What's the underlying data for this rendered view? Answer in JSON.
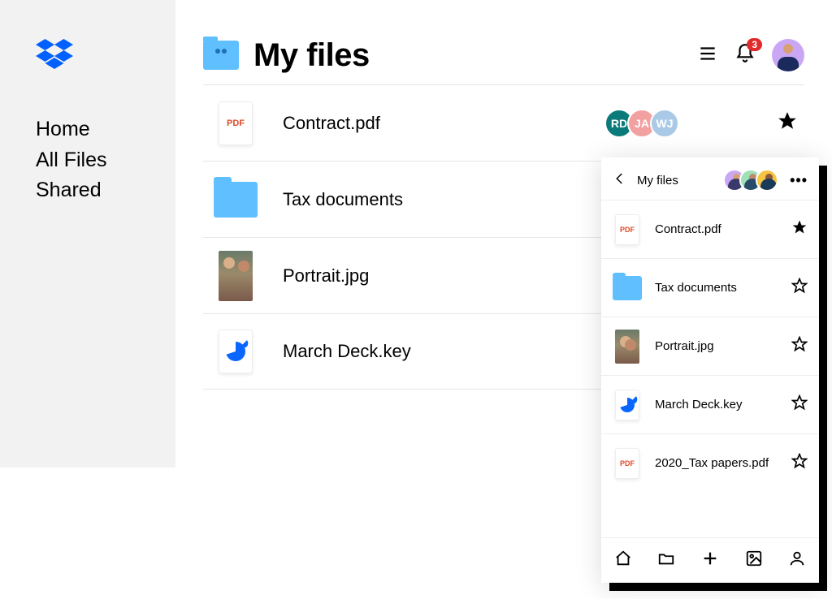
{
  "sidebar": {
    "items": [
      {
        "label": "Home"
      },
      {
        "label": "All Files"
      },
      {
        "label": "Shared"
      }
    ]
  },
  "header": {
    "title": "My files",
    "notification_count": "3"
  },
  "files": [
    {
      "name": "Contract.pdf",
      "type": "pdf",
      "pdf_label": "PDF",
      "starred": true,
      "sharers": [
        {
          "initials": "RD",
          "color": "#0b7a7a"
        },
        {
          "initials": "JA",
          "color": "#f2a0a0"
        },
        {
          "initials": "WJ",
          "color": "#a9c9e6"
        }
      ]
    },
    {
      "name": "Tax documents",
      "type": "folder",
      "starred": false
    },
    {
      "name": "Portrait.jpg",
      "type": "image",
      "starred": false
    },
    {
      "name": "March Deck.key",
      "type": "key",
      "starred": false
    }
  ],
  "mobile": {
    "title": "My files",
    "avatars": [
      {
        "bg": "#c9a7f5"
      },
      {
        "bg": "#9fe0b8"
      },
      {
        "bg": "#f5c542"
      }
    ],
    "files": [
      {
        "name": "Contract.pdf",
        "type": "pdf",
        "pdf_label": "PDF",
        "starred": true
      },
      {
        "name": "Tax documents",
        "type": "folder",
        "starred": false
      },
      {
        "name": "Portrait.jpg",
        "type": "image",
        "starred": false
      },
      {
        "name": "March Deck.key",
        "type": "key",
        "starred": false
      },
      {
        "name": "2020_Tax papers.pdf",
        "type": "pdf",
        "pdf_label": "PDF",
        "starred": false
      }
    ]
  }
}
